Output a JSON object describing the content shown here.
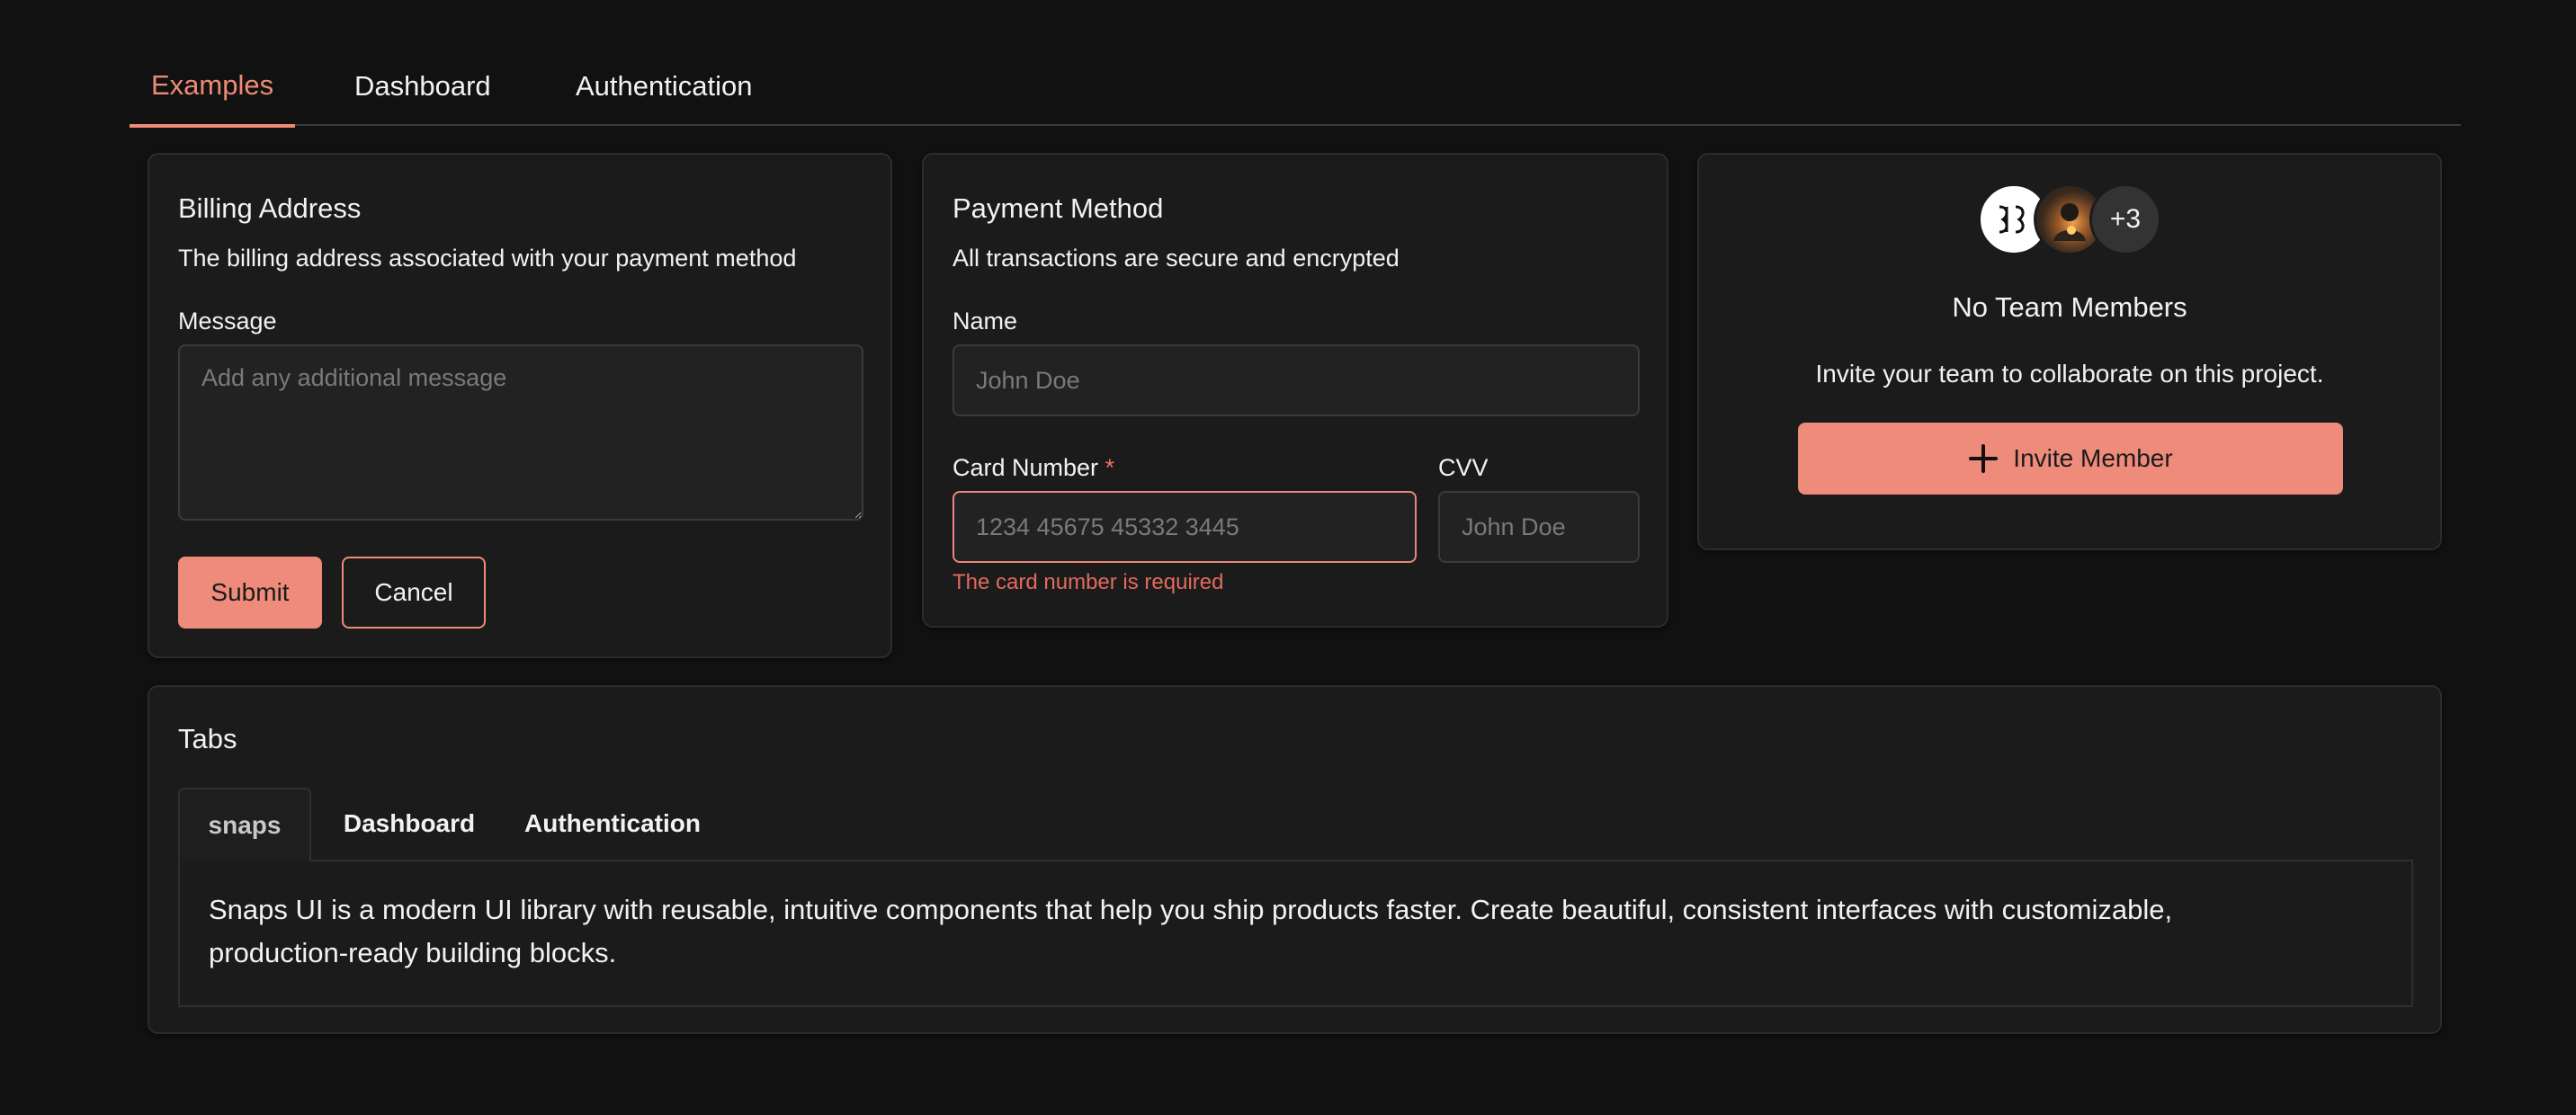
{
  "nav": {
    "tabs": [
      {
        "label": "Examples"
      },
      {
        "label": "Dashboard"
      },
      {
        "label": "Authentication"
      }
    ]
  },
  "billing": {
    "title": "Billing Address",
    "description": "The billing address associated with your payment method",
    "message_label": "Message",
    "message_placeholder": "Add any additional message",
    "submit_label": "Submit",
    "cancel_label": "Cancel"
  },
  "payment": {
    "title": "Payment Method",
    "description": "All transactions are secure and encrypted",
    "name_label": "Name",
    "name_placeholder": "John Doe",
    "card_label": "Card Number",
    "required_mark": "*",
    "card_placeholder": "1234 45675 45332 3445",
    "card_error": "The card number is required",
    "cvv_label": "CVV",
    "cvv_placeholder": "John Doe"
  },
  "team": {
    "avatar_extra": "+3",
    "title": "No Team Members",
    "description": "Invite your team to collaborate on this project.",
    "invite_label": "Invite Member",
    "invite_icon": "plus-icon"
  },
  "tabs_card": {
    "title": "Tabs",
    "tabs": [
      {
        "label": "snaps"
      },
      {
        "label": "Dashboard"
      },
      {
        "label": "Authentication"
      }
    ],
    "active_tab": "snaps",
    "content_line1": "Snaps UI is a modern UI library with reusable, intuitive components that help you ship products faster. Create beautiful, consistent interfaces with customizable,",
    "content_line2": "production-ready building blocks."
  },
  "colors": {
    "accent": "#ee8b7a",
    "background": "#111111",
    "card": "#1b1b1b",
    "error": "#e46a5c"
  }
}
